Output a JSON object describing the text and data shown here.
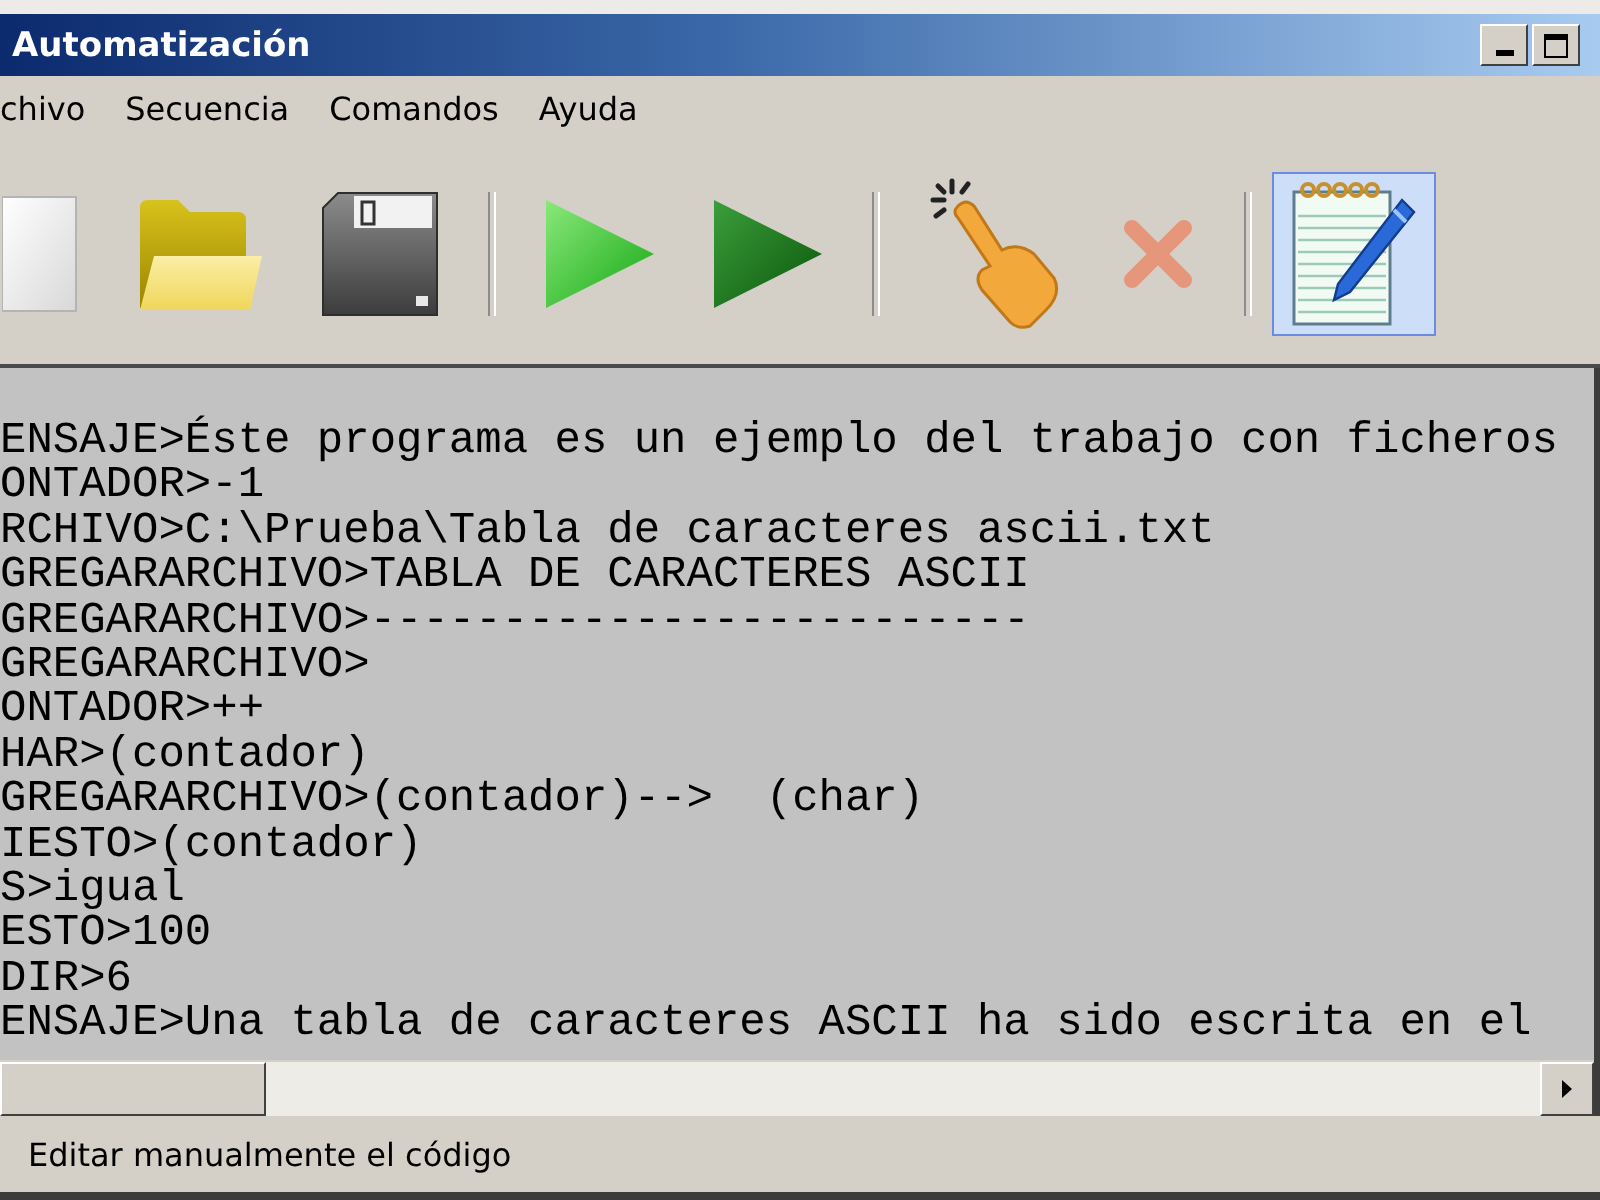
{
  "window": {
    "title": "Automatización"
  },
  "menu": [
    {
      "label": "chivo"
    },
    {
      "label": "Secuencia"
    },
    {
      "label": "Comandos"
    },
    {
      "label": "Ayuda"
    }
  ],
  "toolbar": [
    {
      "kind": "button",
      "selected": false
    },
    {
      "kind": "button",
      "selected": false
    },
    {
      "kind": "button",
      "selected": false
    },
    {
      "kind": "separator"
    },
    {
      "kind": "button",
      "selected": false
    },
    {
      "kind": "button",
      "selected": false
    },
    {
      "kind": "separator"
    },
    {
      "kind": "button",
      "selected": false
    },
    {
      "kind": "button",
      "selected": false
    },
    {
      "kind": "separator"
    },
    {
      "kind": "button",
      "selected": true
    }
  ],
  "editor": {
    "lines": [
      "ENSAJE>Éste programa es un ejemplo del trabajo con ficheros",
      "ONTADOR>-1",
      "RCHIVO>C:\\Prueba\\Tabla de caracteres ascii.txt",
      "GREGARARCHIVO>TABLA DE CARACTERES ASCII",
      "GREGARARCHIVO>-------------------------",
      "GREGARARCHIVO>",
      "ONTADOR>++",
      "HAR>(contador)",
      "GREGARARCHIVO>(contador)-->  (char)",
      "IESTO>(contador)",
      "S>igual",
      "ESTO>100",
      "DIR>6",
      "ENSAJE>Una tabla de caracteres ASCII ha sido escrita en el"
    ]
  },
  "status_bar": {
    "text": "Editar manualmente el código"
  }
}
